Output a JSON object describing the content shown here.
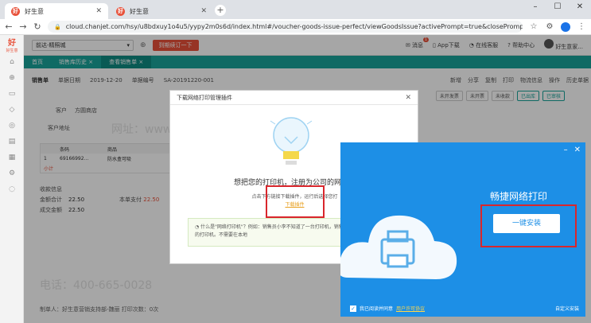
{
  "browser": {
    "tabs": [
      {
        "title": "好生意",
        "favicon": "好"
      },
      {
        "title": "好生意",
        "favicon": "好"
      }
    ],
    "url": "cloud.chanjet.com/hsy/u8bdxuy1o4u5/yypy2m0s6d/index.html#/voucher-goods-issue-perfect/viewGoodsIssue?activePrompt=true&closePrompt=true&closeable..."
  },
  "app": {
    "logo": "好",
    "logo_sub": "好生意",
    "company": "前达-精照城",
    "expire_button": "到期续订一下",
    "header_right": {
      "messages": "消息",
      "messages_badge": "1",
      "app_download": "App下载",
      "online_service": "在线客服",
      "help": "帮助中心",
      "user": "好生意家..."
    },
    "nav_tabs": [
      {
        "label": "首页",
        "active": false
      },
      {
        "label": "销售库历史 ×",
        "active": false
      },
      {
        "label": "查看销售单 ×",
        "active": true
      }
    ],
    "doc": {
      "title": "销售单",
      "date_label": "单据日期",
      "date": "2019-12-20",
      "no_label": "单据编号",
      "no": "SA-20191220-001",
      "actions": [
        "新增",
        "分享",
        "复制",
        "打印",
        "物流信息",
        "操作",
        "历史单据"
      ]
    },
    "status_pills": [
      "未开发票",
      "未开票",
      "未收款",
      "已出库",
      "已审核"
    ],
    "customer_label": "客户",
    "customer": "方圆商店",
    "address_label": "客户地址",
    "grid": {
      "headers": [
        "",
        "条码",
        "商品"
      ],
      "row": [
        "1",
        "69166992...",
        "防水盒可吸"
      ],
      "subtotal": "小计"
    },
    "summary": {
      "title": "收款信息",
      "total_label": "金额合计",
      "total": "22.50",
      "deal_label": "成交金额",
      "deal": "22.50",
      "pay_label": "本单支付",
      "pay": "22.50"
    },
    "footer": "制单人：好生意营销支持部-魏丽    打印次数：0次"
  },
  "plugin_dialog": {
    "title": "下载网络打印管理插件",
    "headline": "想把您的打印机，注册为公司的网络打",
    "instruction": "点击下方链接下载插件，运行后选择您打",
    "link": "下载插件",
    "tip": "什么是\"网络打印机\"？例如：销售员小李不知道了一台打印机，销售员，可以直接选择小李的打印机。不需要在本地"
  },
  "installer": {
    "title": "畅捷网络打印",
    "install_button": "一键安装",
    "agree_prefix": "我已阅读并同意",
    "agree_link": "用户许可协议",
    "custom_install": "自定义安装"
  },
  "watermark": {
    "phone": "电话：400-665-0028",
    "site": "网址：www.chanjet.net"
  },
  "colors": {
    "brand": "#e8513a",
    "nav_green": "#1aa39a",
    "installer_blue": "#1d8fe6",
    "highlight_red": "#d9262c"
  }
}
